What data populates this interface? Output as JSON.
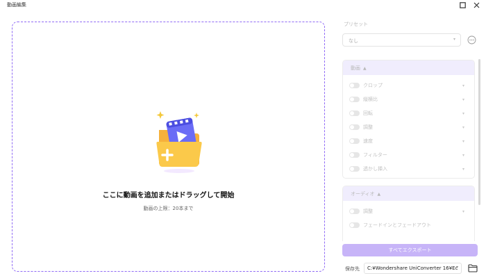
{
  "window": {
    "title": "動画編集"
  },
  "dropzone": {
    "main_text": "ここに動画を追加またはドラッグして開始",
    "sub_text": "動画の上限：20本まで"
  },
  "preset": {
    "label": "プリセット",
    "value": "なし"
  },
  "video_section": {
    "title": "動画",
    "items": [
      {
        "label": "クロップ"
      },
      {
        "label": "縦横比"
      },
      {
        "label": "回転"
      },
      {
        "label": "調整"
      },
      {
        "label": "速度"
      },
      {
        "label": "フィルター"
      },
      {
        "label": "透かし挿入"
      }
    ]
  },
  "audio_section": {
    "title": "オーディオ",
    "items": [
      {
        "label": "調整"
      },
      {
        "label": "フェードインとフェードアウト"
      }
    ]
  },
  "export": {
    "label": "すべてエクスポート"
  },
  "save": {
    "label": "保存先",
    "path": "C:¥Wondershare UniConverter 16¥Ec"
  },
  "colors": {
    "accent": "#8f69f5",
    "export_button": "#c7b4f8",
    "section_header": "#f0edfd"
  }
}
